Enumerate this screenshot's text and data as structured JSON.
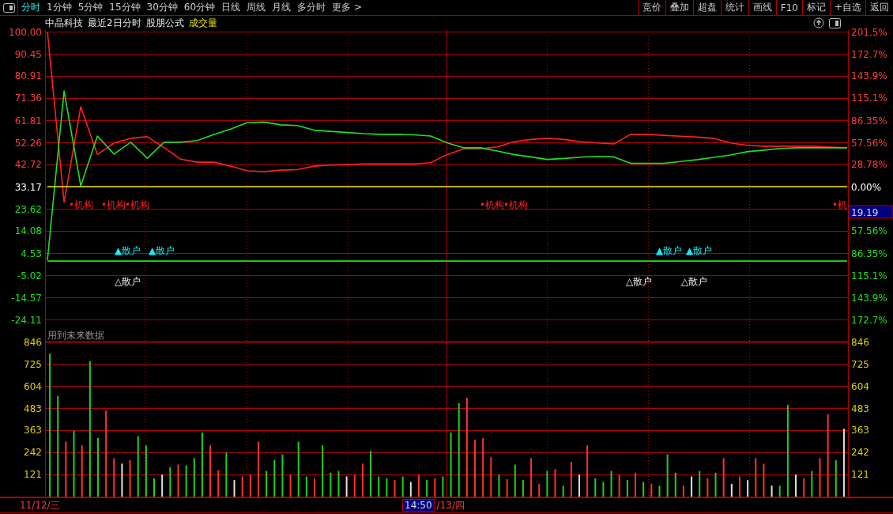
{
  "toolbar": {
    "tabs": [
      {
        "label": "分时",
        "selected": true
      },
      {
        "label": "1分钟",
        "selected": false
      },
      {
        "label": "5分钟",
        "selected": false
      },
      {
        "label": "15分钟",
        "selected": false
      },
      {
        "label": "30分钟",
        "selected": false
      },
      {
        "label": "60分钟",
        "selected": false
      },
      {
        "label": "日线",
        "selected": false
      },
      {
        "label": "周线",
        "selected": false
      },
      {
        "label": "月线",
        "selected": false
      },
      {
        "label": "多分时",
        "selected": false
      },
      {
        "label": "更多 >",
        "selected": false
      }
    ],
    "buttons": [
      "竞价",
      "叠加",
      "超盘",
      "统计",
      "画线",
      "F10",
      "标记",
      "+自选",
      "返回"
    ]
  },
  "info_bar": [
    {
      "text": "中晶科技",
      "kind": "title"
    },
    {
      "text": "最近2日分时",
      "kind": "title"
    },
    {
      "text": "股朋公式",
      "kind": "title"
    },
    {
      "text": "成交量",
      "kind": "indicator"
    }
  ],
  "price_panel": {
    "chart_data": {
      "type": "line",
      "grid": true,
      "categories": [
        null,
        null,
        null,
        null,
        null,
        null,
        null,
        null,
        null,
        null,
        null,
        null,
        null,
        null,
        null,
        null,
        null,
        null,
        null,
        null,
        null,
        null,
        null,
        null,
        null,
        null,
        null,
        null,
        null,
        null,
        null,
        null,
        null,
        null,
        null,
        null,
        null,
        null,
        null,
        null,
        null,
        null,
        null,
        null,
        null,
        null,
        null,
        null,
        null
      ],
      "series": [
        {
          "color": "#ff2020",
          "values": [
            100,
            26.5,
            67.6,
            47,
            52,
            54,
            54.7,
            50,
            45,
            43.7,
            43.7,
            42,
            40,
            39.6,
            40.3,
            40.5,
            42,
            42.5,
            42.7,
            43,
            43,
            43,
            43,
            43.5,
            47,
            49.5,
            49.5,
            50.3,
            52.5,
            53.5,
            54,
            53.5,
            52.5,
            52,
            51.6,
            55.7,
            55.7,
            55.3,
            54.9,
            54.5,
            54,
            52,
            51,
            50.6,
            50.6,
            50.6,
            50.6,
            50.2,
            49.9
          ]
        },
        {
          "color": "#20e020",
          "values": [
            1.5,
            74.4,
            33.5,
            55,
            47.2,
            52.3,
            45.4,
            52.3,
            52.3,
            53,
            55.7,
            58,
            60.8,
            61,
            59.8,
            59.5,
            57.5,
            57,
            56.5,
            56,
            55.7,
            55.7,
            55.5,
            55,
            52,
            49.9,
            49.9,
            48.5,
            47,
            46,
            44.9,
            45.3,
            45.9,
            46.2,
            46,
            43.2,
            43.2,
            43.2,
            44,
            44.8,
            45.8,
            46.8,
            48.2,
            48.9,
            49.6,
            49.9,
            49.9,
            49.9,
            49.9
          ]
        },
        {
          "color": "#e8e800",
          "values": [
            33.17,
            33.17,
            33.17,
            33.17,
            33.17,
            33.17,
            33.17,
            33.17,
            33.17,
            33.17,
            33.17,
            33.17,
            33.17,
            33.17,
            33.17,
            33.17,
            33.17,
            33.17,
            33.17,
            33.17,
            33.17,
            33.17,
            33.17,
            33.17,
            33.17,
            33.17,
            33.17,
            33.17,
            33.17,
            33.17,
            33.17,
            33.17,
            33.17,
            33.17,
            33.17,
            33.17,
            33.17,
            33.17,
            33.17,
            33.17,
            33.17,
            33.17,
            33.17,
            33.17,
            33.17,
            33.17,
            33.17,
            33.17,
            33.17
          ]
        },
        {
          "color": "#20e020",
          "values": [
            1.1,
            1.1,
            1.1,
            1.1,
            1.1,
            1.1,
            1.1,
            1.1,
            1.1,
            1.1,
            1.1,
            1.1,
            1.1,
            1.1,
            1.1,
            1.1,
            1.1,
            1.1,
            1.1,
            1.1,
            1.1,
            1.1,
            1.1,
            1.1,
            1.1,
            1.1,
            1.1,
            1.1,
            1.1,
            1.1,
            1.1,
            1.1,
            1.1,
            1.1,
            1.1,
            1.1,
            1.1,
            1.1,
            1.1,
            1.1,
            1.1,
            1.1,
            1.1,
            1.1,
            1.1,
            1.1,
            1.1,
            1.1,
            1.1
          ]
        }
      ],
      "ylim": [
        -24.11,
        100
      ],
      "yticks": [
        {
          "value": 100,
          "label": "100.00"
        },
        {
          "value": 90.45,
          "label": "90.45"
        },
        {
          "value": 80.91,
          "label": "80.91"
        },
        {
          "value": 71.36,
          "label": "71.36"
        },
        {
          "value": 61.81,
          "label": "61.81"
        },
        {
          "value": 52.26,
          "label": "52.26"
        },
        {
          "value": 42.72,
          "label": "42.72"
        },
        {
          "value": 33.17,
          "label": "33.17"
        },
        {
          "value": 23.62,
          "label": "23.62"
        },
        {
          "value": 14.08,
          "label": "14.08"
        },
        {
          "value": 4.53,
          "label": "4.53"
        },
        {
          "value": -5.02,
          "label": "-5.02"
        },
        {
          "value": -14.57,
          "label": "-14.57"
        },
        {
          "value": -24.11,
          "label": "-24.11"
        }
      ]
    },
    "signals": [
      {
        "text": "•机构",
        "kind": "institution"
      },
      {
        "text": "•机构",
        "kind": "institution"
      },
      {
        "text": "•机构",
        "kind": "institution"
      },
      {
        "text": "•机构",
        "kind": "institution"
      },
      {
        "text": "•机构",
        "kind": "institution"
      },
      {
        "text": "•机",
        "kind": "institution"
      },
      {
        "text": "▲散户",
        "kind": "retail-up"
      },
      {
        "text": "▲散户",
        "kind": "retail-up"
      },
      {
        "text": "▲散户",
        "kind": "retail-up"
      },
      {
        "text": "▲散户",
        "kind": "retail-up"
      },
      {
        "text": "△散户",
        "kind": "retail-down"
      },
      {
        "text": "△散户",
        "kind": "retail-down"
      },
      {
        "text": "△散户",
        "kind": "retail-down"
      }
    ],
    "right_axis": [
      {
        "text": "201.5%",
        "kind": "up"
      },
      {
        "text": "172.7%",
        "kind": "up"
      },
      {
        "text": "143.9%",
        "kind": "up"
      },
      {
        "text": "115.1%",
        "kind": "up"
      },
      {
        "text": "86.35%",
        "kind": "up"
      },
      {
        "text": "57.56%",
        "kind": "up"
      },
      {
        "text": "28.78%",
        "kind": "up"
      },
      {
        "text": "0.00%",
        "kind": "zero"
      },
      {
        "text": "19.19",
        "kind": "readout"
      },
      {
        "text": "57.56%",
        "kind": "down"
      },
      {
        "text": "86.35%",
        "kind": "down"
      },
      {
        "text": "115.1%",
        "kind": "down"
      },
      {
        "text": "143.9%",
        "kind": "down"
      },
      {
        "text": "172.7%",
        "kind": "down"
      }
    ]
  },
  "volume_panel": {
    "notice": "用到未来数据",
    "chart_data": {
      "type": "bar",
      "grid": true,
      "ylim": [
        0,
        846
      ],
      "yticks": [
        {
          "value": 846,
          "label": "846"
        },
        {
          "value": 725,
          "label": "725"
        },
        {
          "value": 604,
          "label": "604"
        },
        {
          "value": 483,
          "label": "483"
        },
        {
          "value": 363,
          "label": "363"
        },
        {
          "value": 242,
          "label": "242"
        },
        {
          "value": 121,
          "label": "121"
        }
      ],
      "series": [
        {
          "color": "#ff3030",
          "values": [
            null,
            null,
            300,
            null,
            280,
            null,
            null,
            470,
            210,
            null,
            200,
            null,
            null,
            null,
            null,
            null,
            175,
            null,
            null,
            null,
            280,
            145,
            null,
            null,
            110,
            120,
            300,
            null,
            null,
            null,
            120,
            null,
            null,
            100,
            null,
            null,
            null,
            null,
            120,
            180,
            null,
            null,
            null,
            90,
            null,
            null,
            120,
            null,
            100,
            null,
            null,
            null,
            540,
            310,
            320,
            215,
            null,
            95,
            null,
            null,
            210,
            70,
            null,
            150,
            null,
            190,
            null,
            280,
            null,
            null,
            null,
            120,
            null,
            130,
            null,
            70,
            null,
            null,
            null,
            60,
            null,
            null,
            100,
            null,
            210,
            null,
            110,
            null,
            210,
            180,
            null,
            null,
            null,
            null,
            100,
            null,
            210,
            450,
            null,
            null
          ]
        },
        {
          "color": "#20d020",
          "values": [
            780,
            550,
            null,
            360,
            null,
            740,
            320,
            null,
            null,
            null,
            null,
            330,
            280,
            100,
            null,
            160,
            null,
            170,
            210,
            350,
            null,
            null,
            240,
            null,
            null,
            null,
            null,
            140,
            200,
            230,
            null,
            300,
            110,
            null,
            280,
            130,
            140,
            null,
            null,
            null,
            250,
            110,
            100,
            null,
            110,
            null,
            null,
            90,
            null,
            110,
            350,
            510,
            null,
            null,
            null,
            null,
            120,
            null,
            175,
            90,
            null,
            null,
            140,
            null,
            60,
            null,
            null,
            null,
            100,
            80,
            140,
            null,
            90,
            null,
            80,
            null,
            60,
            230,
            130,
            null,
            null,
            140,
            null,
            130,
            null,
            null,
            null,
            null,
            null,
            null,
            null,
            60,
            500,
            null,
            null,
            140,
            null,
            null,
            200,
            null
          ]
        },
        {
          "color": "#e0e0e0",
          "values": [
            null,
            null,
            null,
            null,
            null,
            null,
            null,
            null,
            null,
            180,
            null,
            null,
            null,
            null,
            120,
            null,
            null,
            null,
            null,
            null,
            null,
            null,
            null,
            90,
            null,
            null,
            null,
            null,
            null,
            null,
            null,
            null,
            null,
            null,
            null,
            null,
            null,
            110,
            null,
            null,
            null,
            null,
            null,
            null,
            null,
            80,
            null,
            null,
            null,
            null,
            null,
            null,
            null,
            null,
            null,
            null,
            null,
            null,
            null,
            null,
            null,
            null,
            null,
            null,
            null,
            null,
            120,
            null,
            null,
            null,
            null,
            null,
            null,
            null,
            null,
            null,
            null,
            null,
            null,
            null,
            110,
            null,
            null,
            null,
            null,
            70,
            null,
            90,
            null,
            null,
            60,
            null,
            null,
            120,
            null,
            null,
            null,
            null,
            null,
            370
          ]
        }
      ]
    },
    "right_yticks": [
      "846",
      "725",
      "604",
      "483",
      "363",
      "242",
      "121"
    ]
  },
  "date_bar": [
    {
      "text": "11/12/三",
      "kind": "date"
    },
    {
      "text": "14:50",
      "kind": "cursor"
    },
    {
      "text": "/13/四",
      "kind": "date"
    }
  ]
}
